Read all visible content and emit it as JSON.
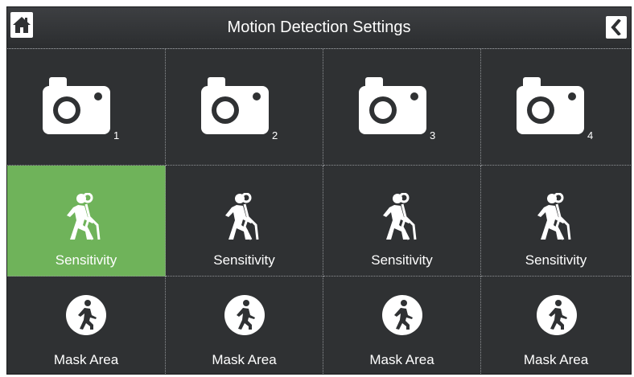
{
  "header": {
    "title": "Motion Detection Settings",
    "home_icon": "home-icon",
    "back_icon": "chevron-left-icon"
  },
  "colors": {
    "background": "#2f3133",
    "active": "#6fb35a",
    "divider": "#8f9295",
    "text": "#ffffff"
  },
  "cameras": [
    {
      "number": "1",
      "icon": "camera-icon"
    },
    {
      "number": "2",
      "icon": "camera-icon"
    },
    {
      "number": "3",
      "icon": "camera-icon"
    },
    {
      "number": "4",
      "icon": "camera-icon"
    }
  ],
  "sensitivity": [
    {
      "label": "Sensitivity",
      "selected": true,
      "icon": "motion-walker-icon"
    },
    {
      "label": "Sensitivity",
      "selected": false,
      "icon": "motion-walker-icon"
    },
    {
      "label": "Sensitivity",
      "selected": false,
      "icon": "motion-walker-icon"
    },
    {
      "label": "Sensitivity",
      "selected": false,
      "icon": "motion-walker-icon"
    }
  ],
  "mask_area": [
    {
      "label": "Mask Area",
      "icon": "walker-circle-icon"
    },
    {
      "label": "Mask Area",
      "icon": "walker-circle-icon"
    },
    {
      "label": "Mask Area",
      "icon": "walker-circle-icon"
    },
    {
      "label": "Mask Area",
      "icon": "walker-circle-icon"
    }
  ]
}
